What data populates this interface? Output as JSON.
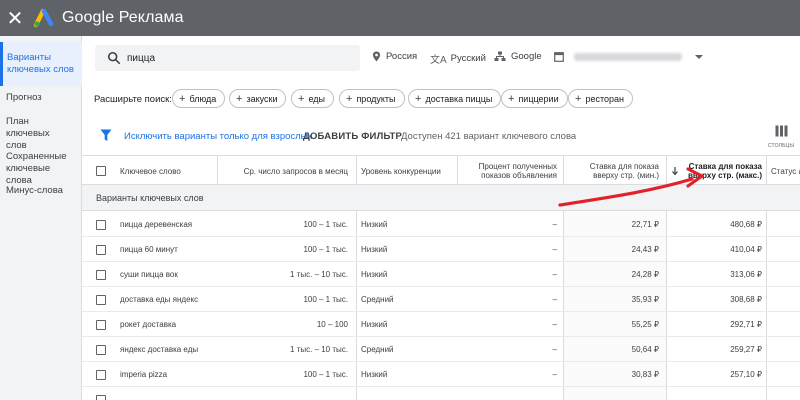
{
  "app": {
    "title": "Google Реклама",
    "close": "✕"
  },
  "sidebar": {
    "items": [
      {
        "label": "Варианты ключевых слов",
        "active": true
      },
      {
        "label": "Прогноз",
        "active": false
      },
      {
        "label": "План ключевых слов",
        "active": false
      },
      {
        "label": "Сохраненные ключевые слова",
        "active": false
      },
      {
        "label": "Минус-слова",
        "active": false
      }
    ]
  },
  "search": {
    "value": "пицца",
    "location": "Россия",
    "language": "Русский",
    "network": "Google"
  },
  "expand": {
    "label": "Расширьте поиск:",
    "chips": [
      "блюда",
      "закуски",
      "еды",
      "продукты",
      "доставка пиццы",
      "пиццерии",
      "ресторан"
    ]
  },
  "filters": {
    "exclude_adult": "Исключить варианты только для взрослых",
    "add_filter": "ДОБАВИТЬ ФИЛЬТР",
    "available": "Доступен 421 вариант ключевого слова",
    "columns_label": "СТОЛБЦЫ"
  },
  "table": {
    "headers": {
      "keyword": "Ключевое слово",
      "avg_searches": "Ср. число запросов в месяц",
      "competition": "Уровень конкуренции",
      "impr_share": "Процент полученных показов объявления",
      "bid_low": "Ставка для показа вверху стр. (мин.)",
      "bid_high": "Ставка для показа вверху стр. (макс.)",
      "status": "Статус а"
    },
    "group_label": "Варианты ключевых слов",
    "rows": [
      {
        "keyword": "пицца деревенская",
        "searches": "100 – 1 тыс.",
        "competition": "Низкий",
        "share": "–",
        "low": "22,71 ₽",
        "high": "480,68 ₽"
      },
      {
        "keyword": "пицца 60 минут",
        "searches": "100 – 1 тыс.",
        "competition": "Низкий",
        "share": "–",
        "low": "24,43 ₽",
        "high": "410,04 ₽"
      },
      {
        "keyword": "суши пицца вок",
        "searches": "1 тыс. – 10 тыс.",
        "competition": "Низкий",
        "share": "–",
        "low": "24,28 ₽",
        "high": "313,06 ₽"
      },
      {
        "keyword": "доставка еды яндекс",
        "searches": "100 – 1 тыс.",
        "competition": "Средний",
        "share": "–",
        "low": "35,93 ₽",
        "high": "308,68 ₽"
      },
      {
        "keyword": "рокет доставка",
        "searches": "10 – 100",
        "competition": "Низкий",
        "share": "–",
        "low": "55,25 ₽",
        "high": "292,71 ₽"
      },
      {
        "keyword": "яндекс доставка еды",
        "searches": "1 тыс. – 10 тыс.",
        "competition": "Средний",
        "share": "–",
        "low": "50,64 ₽",
        "high": "259,27 ₽"
      },
      {
        "keyword": "imperia pizza",
        "searches": "100 – 1 тыс.",
        "competition": "Низкий",
        "share": "–",
        "low": "30,83 ₽",
        "high": "257,10 ₽"
      },
      {
        "keyword": "",
        "searches": "",
        "competition": "",
        "share": "",
        "low": "",
        "high": ""
      }
    ]
  }
}
